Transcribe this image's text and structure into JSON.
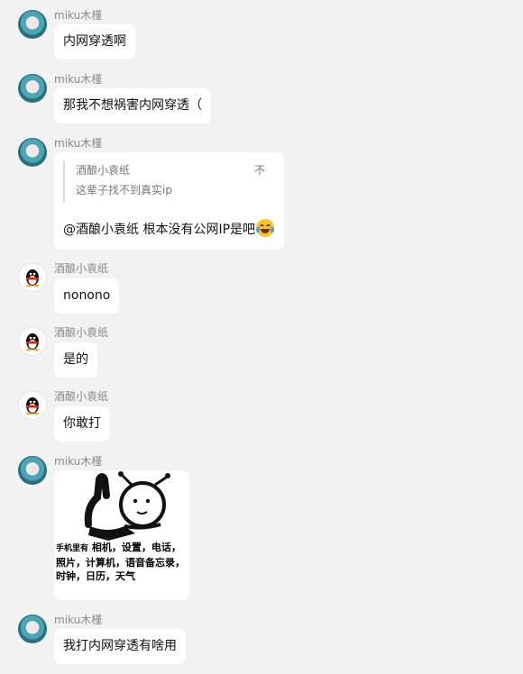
{
  "chat": {
    "messages": [
      {
        "sender": "miku木槿",
        "avatar": "miku-avatar-icon",
        "text": "内网穿透啊"
      },
      {
        "sender": "miku木槿",
        "avatar": "miku-avatar-icon",
        "text": "那我不想祸害内网穿透（"
      },
      {
        "sender": "miku木槿",
        "avatar": "miku-avatar-icon",
        "reply": {
          "name": "酒酿小袁纸",
          "flag": "不",
          "text": "这辈子找不到真实ip"
        },
        "text": "@酒酿小袁纸 根本没有公网IP是吧",
        "emoji": "tears-of-joy-emoji-icon"
      },
      {
        "sender": "酒酿小袁纸",
        "avatar": "qq-penguin-avatar-icon",
        "text": "nonono"
      },
      {
        "sender": "酒酿小袁纸",
        "avatar": "qq-penguin-avatar-icon",
        "text": "是的"
      },
      {
        "sender": "酒酿小袁纸",
        "avatar": "qq-penguin-avatar-icon",
        "text": "你敢打"
      },
      {
        "sender": "miku木槿",
        "avatar": "miku-avatar-icon",
        "image": {
          "caption_prefix": "手机里有",
          "caption": "相机，设置，电话，照片，计算机，语音备忘录，时钟，日历，天气"
        }
      },
      {
        "sender": "miku木槿",
        "avatar": "miku-avatar-icon",
        "text": "我打内网穿透有啥用"
      }
    ]
  },
  "colors": {
    "background": "#f2f2f2",
    "bubble": "#ffffff",
    "sender_name": "#8a8a8a",
    "text": "#111111"
  }
}
